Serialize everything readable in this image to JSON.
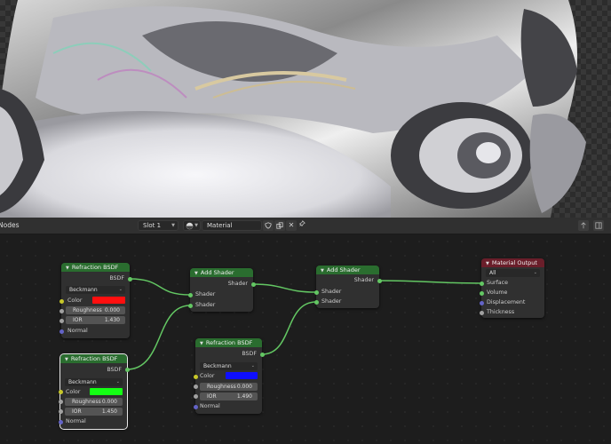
{
  "header": {
    "editor_label": "Nodes",
    "slot_value": "Slot 1",
    "material_value": "Material"
  },
  "nodes": {
    "refraction_red": {
      "title": "Refraction BSDF",
      "output": "BSDF",
      "distribution": "Beckmann",
      "color_label": "Color",
      "color_value": "#ff0f0f",
      "roughness_label": "Roughness",
      "roughness_value": "0.000",
      "ior_label": "IOR",
      "ior_value": "1.430",
      "normal_label": "Normal"
    },
    "refraction_green": {
      "title": "Refraction BSDF",
      "output": "BSDF",
      "distribution": "Beckmann",
      "color_label": "Color",
      "color_value": "#14ff14",
      "roughness_label": "Roughness",
      "roughness_value": "0.000",
      "ior_label": "IOR",
      "ior_value": "1.450",
      "normal_label": "Normal"
    },
    "refraction_blue": {
      "title": "Refraction BSDF",
      "output": "BSDF",
      "distribution": "Beckmann",
      "color_label": "Color",
      "color_value": "#0f0fff",
      "roughness_label": "Roughness",
      "roughness_value": "0.000",
      "ior_label": "IOR",
      "ior_value": "1.490",
      "normal_label": "Normal"
    },
    "add_shader_1": {
      "title": "Add Shader",
      "output": "Shader",
      "input_a": "Shader",
      "input_b": "Shader"
    },
    "add_shader_2": {
      "title": "Add Shader",
      "output": "Shader",
      "input_a": "Shader",
      "input_b": "Shader"
    },
    "material_output": {
      "title": "Material Output",
      "target": "All",
      "surface": "Surface",
      "volume": "Volume",
      "displacement": "Displacement",
      "thickness": "Thickness"
    }
  },
  "colors": {
    "shader_header": "#2a6d2f",
    "output_header": "#6a1e2a",
    "socket_shader": "#63c763",
    "socket_color": "#c7c729",
    "socket_value": "#a1a1a1",
    "socket_vector": "#6363c7"
  },
  "icons": {
    "editor_type": "node-editor-icon",
    "material_browse": "material-sphere-icon",
    "fake_user": "shield-icon",
    "duplicate": "duplicate-icon",
    "unlink": "close-icon",
    "pin": "pin-icon"
  }
}
